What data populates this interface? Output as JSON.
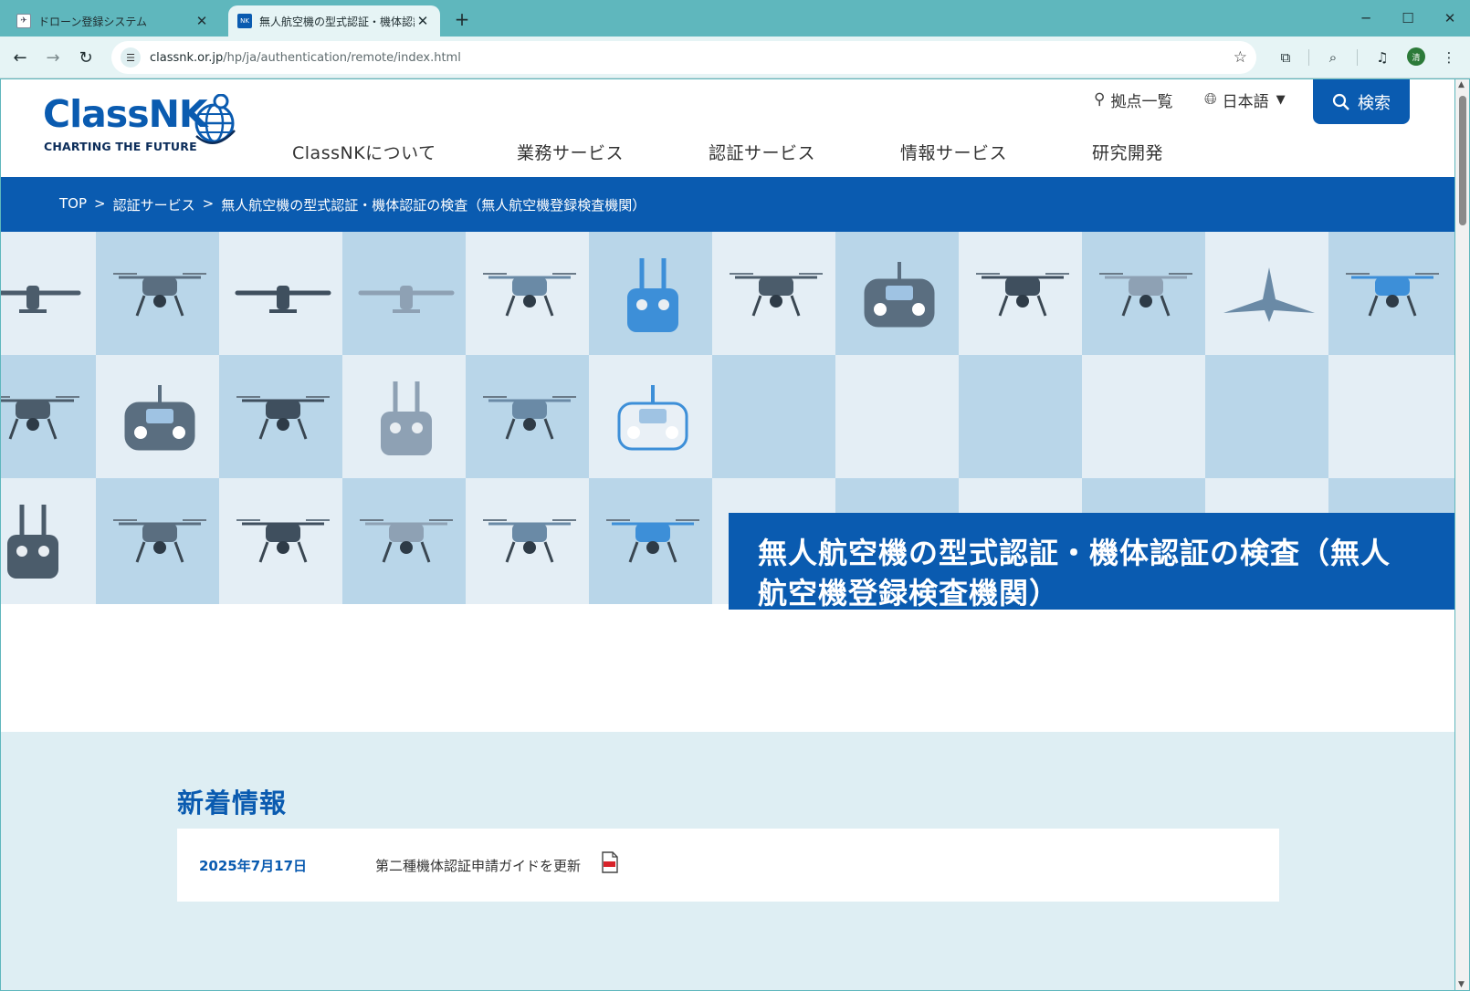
{
  "browser": {
    "tabs": [
      {
        "title": "ドローン登録システム",
        "active": false
      },
      {
        "title": "無人航空機の型式認証・機体認証",
        "active": true
      }
    ],
    "url_host": "classnk.or.jp",
    "url_path": "/hp/ja/authentication/remote/index.html",
    "profile_initial": "清"
  },
  "header": {
    "logo_text": "ClassNK",
    "logo_tagline": "CHARTING THE FUTURE",
    "locations_label": "拠点一覧",
    "language_label": "日本語",
    "search_label": "検索",
    "nav": [
      "ClassNKについて",
      "業務サービス",
      "認証サービス",
      "情報サービス",
      "研究開発"
    ]
  },
  "breadcrumb": {
    "items": [
      "TOP",
      "認証サービス",
      "無人航空機の型式認証・機体認証の検査（無人航空機登録検査機関）"
    ],
    "separator": ">"
  },
  "hero": {
    "title_line1": "無人航空機の型式認証・機体認証の検査（無人",
    "title_line2": "航空機登録検査機関）"
  },
  "news": {
    "heading": "新着情報",
    "items": [
      {
        "date": "2025年7月17日",
        "title": "第二種機体認証申請ガイドを更新",
        "has_pdf": true
      }
    ]
  },
  "colors": {
    "brand_blue": "#0a5bb0",
    "tab_strip": "#5fb7bd",
    "tile_light": "#e4eef5",
    "tile_mid": "#b9d6e9",
    "news_bg": "#deeef3"
  }
}
